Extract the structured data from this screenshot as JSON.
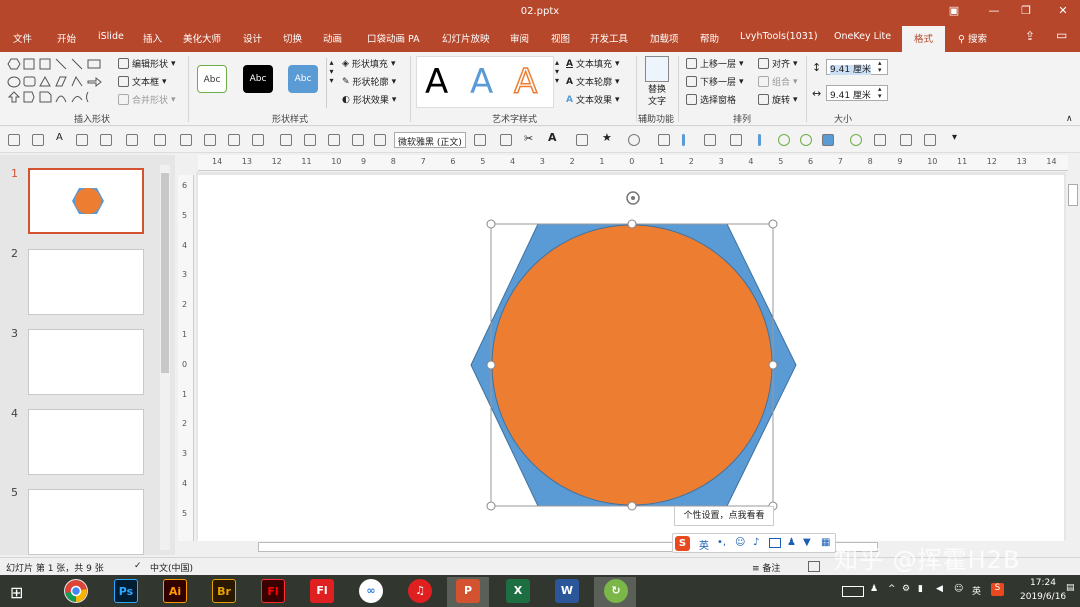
{
  "window": {
    "title": "02.pptx"
  },
  "tabs": [
    {
      "label": "文件"
    },
    {
      "label": "开始"
    },
    {
      "label": "iSlide"
    },
    {
      "label": "插入"
    },
    {
      "label": "美化大师"
    },
    {
      "label": "设计"
    },
    {
      "label": "切换"
    },
    {
      "label": "动画"
    },
    {
      "label": "口袋动画 PA"
    },
    {
      "label": "幻灯片放映"
    },
    {
      "label": "审阅"
    },
    {
      "label": "视图"
    },
    {
      "label": "开发工具"
    },
    {
      "label": "加载项"
    },
    {
      "label": "帮助"
    },
    {
      "label": "LvyhTools(1031)"
    },
    {
      "label": "OneKey Lite"
    },
    {
      "label": "格式"
    }
  ],
  "search_label": "搜索",
  "ribbon": {
    "insert_shapes": {
      "label": "插入形状",
      "edit_shape": "编辑形状",
      "textbox": "文本框",
      "merge_shapes": "合并形状"
    },
    "shape_styles": {
      "label": "形状样式",
      "samples": [
        "Abc",
        "Abc",
        "Abc"
      ],
      "fill": "形状填充",
      "outline": "形状轮廓",
      "effects": "形状效果"
    },
    "wordart": {
      "label": "艺术字样式",
      "letter": "A",
      "text_fill": "文本填充",
      "text_outline": "文本轮廓",
      "text_effects": "文本效果"
    },
    "accessibility": {
      "label": "辅助功能",
      "alt_text_line1": "替换",
      "alt_text_line2": "文字"
    },
    "arrange": {
      "label": "排列",
      "bring_forward": "上移一层",
      "send_backward": "下移一层",
      "selection_pane": "选择窗格",
      "align": "对齐",
      "group": "组合",
      "rotate": "旋转"
    },
    "size": {
      "label": "大小",
      "height": "9.41 厘米",
      "width": "9.41 厘米"
    }
  },
  "qat": {
    "font": "微软雅黑 (正文)"
  },
  "ruler": {
    "h": [
      "14",
      "13",
      "12",
      "11",
      "10",
      "9",
      "8",
      "7",
      "6",
      "5",
      "4",
      "3",
      "2",
      "1",
      "0",
      "1",
      "2",
      "3",
      "4",
      "5",
      "6",
      "7",
      "8",
      "9",
      "10",
      "11",
      "12",
      "13",
      "14"
    ],
    "v": [
      "6",
      "5",
      "4",
      "3",
      "2",
      "1",
      "0",
      "1",
      "2",
      "3",
      "4",
      "5"
    ]
  },
  "slides": [
    {
      "number": "1"
    },
    {
      "number": "2"
    },
    {
      "number": "3"
    },
    {
      "number": "4"
    },
    {
      "number": "5"
    }
  ],
  "shapes": {
    "hexagon_color": "#5b9bd5",
    "circle_color": "#ed7d31",
    "outline_color": "#41719c"
  },
  "tooltip": "个性设置，点我看看",
  "ime": {
    "lang": "英"
  },
  "watermark": "知乎 @挥霍H2B",
  "status": {
    "slide_info": "幻灯片 第 1 张，共 9 张",
    "language": "中文(中国)",
    "notes": "备注"
  },
  "taskbar": {
    "apps": [
      {
        "label": "Ps"
      },
      {
        "label": "Ai"
      },
      {
        "label": "Br"
      },
      {
        "label": "Fl"
      },
      {
        "label": "Fl"
      },
      {
        "label": "P"
      },
      {
        "label": "X"
      },
      {
        "label": "W"
      }
    ],
    "ime_lang": "英",
    "time": "17:24",
    "date": "2019/6/16"
  }
}
